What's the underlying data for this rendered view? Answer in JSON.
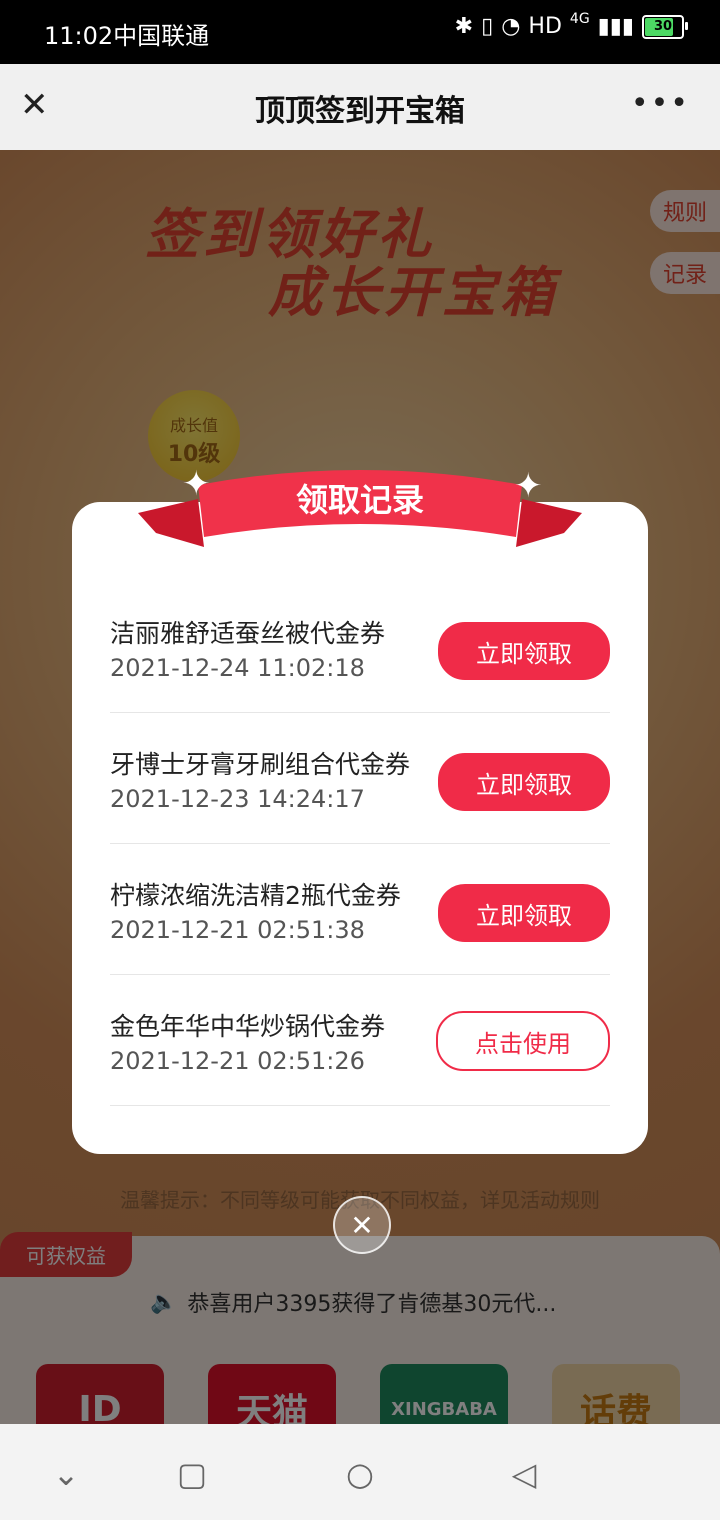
{
  "status_bar": {
    "time_carrier": "11:02中国联通",
    "right_text": "HD",
    "network": "4G",
    "battery": "30"
  },
  "navbar": {
    "title": "顶顶签到开宝箱",
    "close_icon": "close-icon",
    "more_icon": "more-icon"
  },
  "page": {
    "headline_line1": "签到领好礼",
    "headline_line2": "成长开宝箱",
    "rules": "规则",
    "records": "记录",
    "growth_label": "成长值",
    "growth_level": "10级",
    "tip": "温馨提示：不同等级可能获取不同权益，详见活动规则",
    "rights_tag": "可获权益",
    "marquee": "恭喜用户3395获得了肯德基30元代...",
    "tiles": [
      "ID",
      "天猫",
      "XINGBABA",
      "话费"
    ]
  },
  "dialog": {
    "title": "领取记录",
    "items": [
      {
        "name": "洁丽雅舒适蚕丝被代金券",
        "time": "2021-12-24 11:02:18",
        "action": "立即领取"
      },
      {
        "name": "牙博士牙膏牙刷组合代金券",
        "time": "2021-12-23 14:24:17",
        "action": "立即领取"
      },
      {
        "name": "柠檬浓缩洗洁精2瓶代金券",
        "time": "2021-12-21 02:51:38",
        "action": "立即领取"
      },
      {
        "name": "金色年华中华炒锅代金券",
        "time": "2021-12-21 02:51:26",
        "action": "点击使用"
      }
    ]
  },
  "colors": {
    "accent": "#f02b48",
    "headline": "#e24330"
  }
}
